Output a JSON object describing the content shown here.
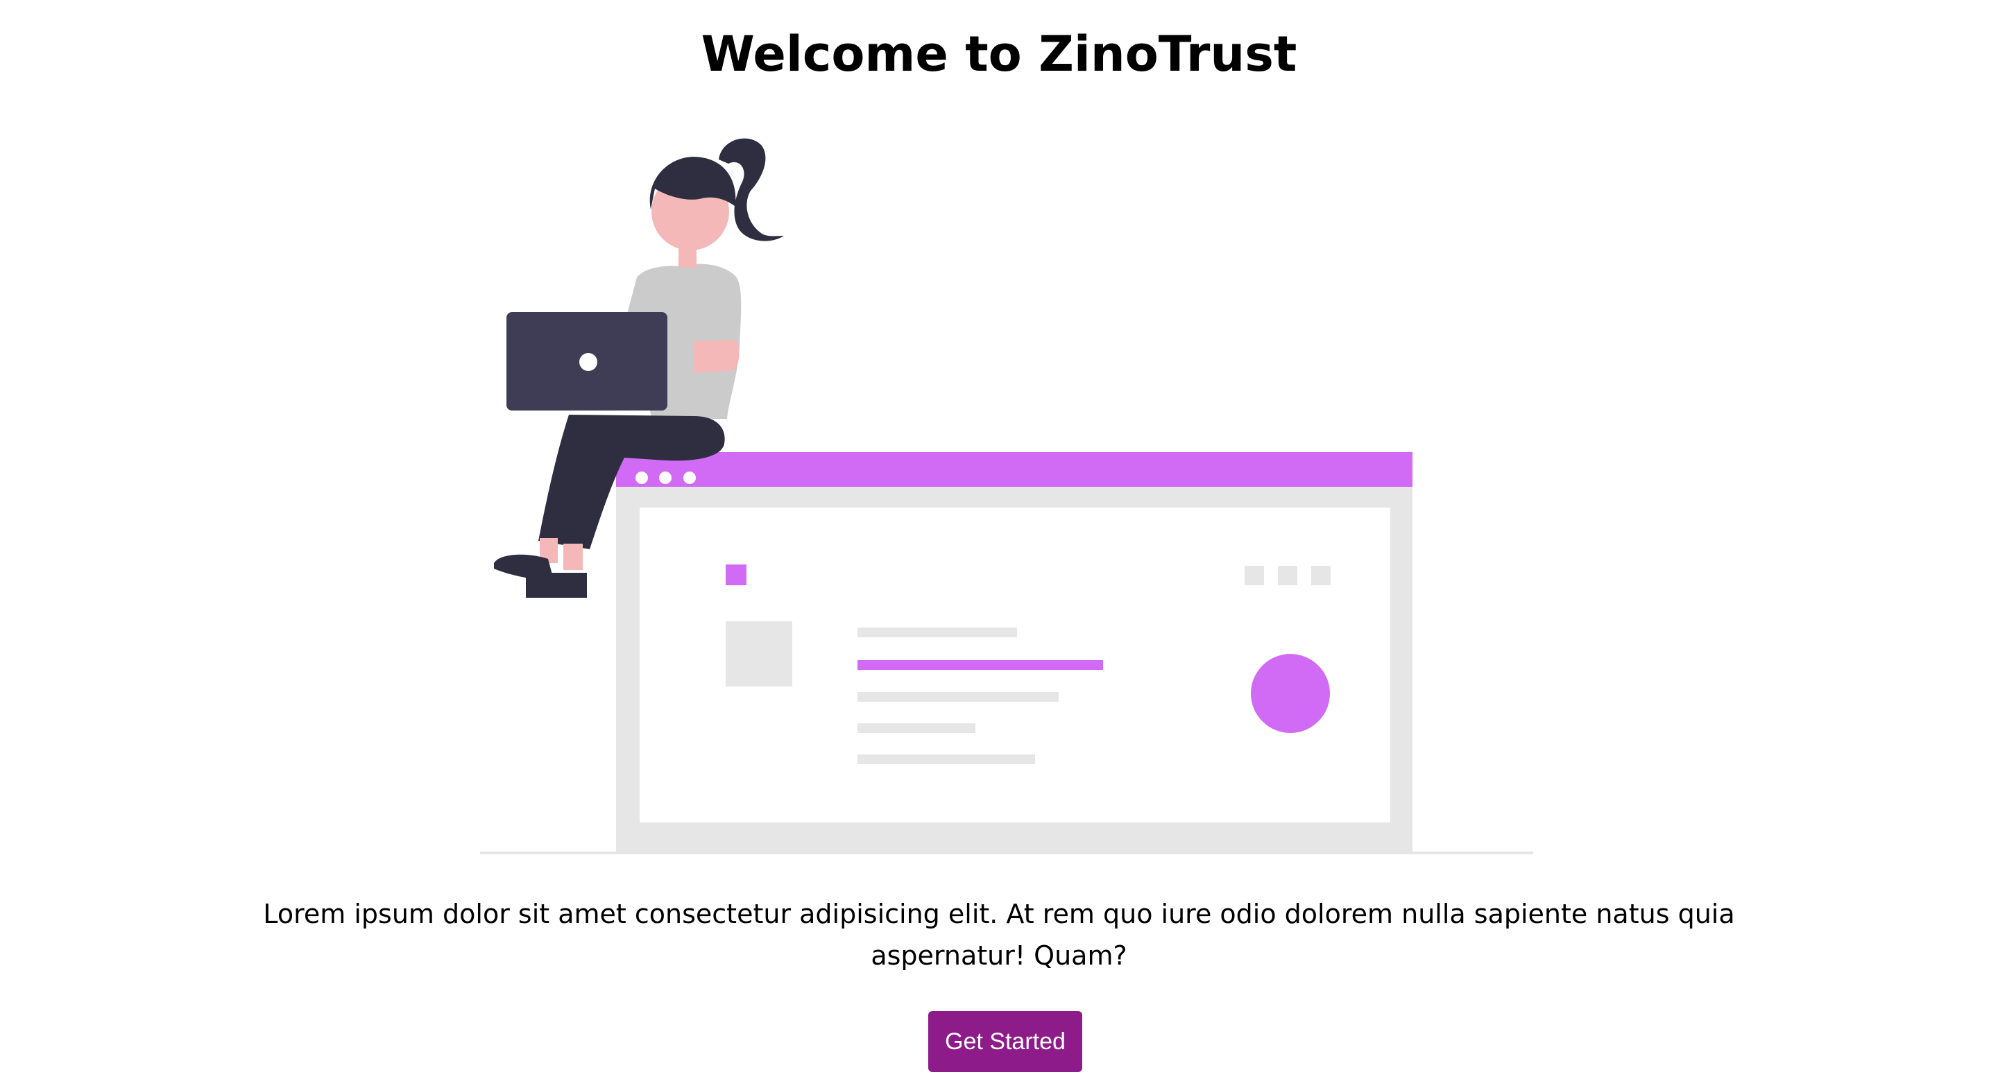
{
  "page": {
    "title": "Welcome to ZinoTrust",
    "description": "Lorem ipsum dolor sit amet consectetur adipisicing elit. At rem quo iure odio dolorem nulla sapiente natus quia aspernatur! Quam?",
    "cta_label": "Get Started"
  },
  "colors": {
    "accent": "#d16bf6",
    "button": "#8e1b8a",
    "dark": "#2f2e41",
    "laptop": "#3f3d56",
    "skin": "#f4b8b8",
    "shirt": "#cbcbcb",
    "browser_gray": "#e6e6e6"
  }
}
